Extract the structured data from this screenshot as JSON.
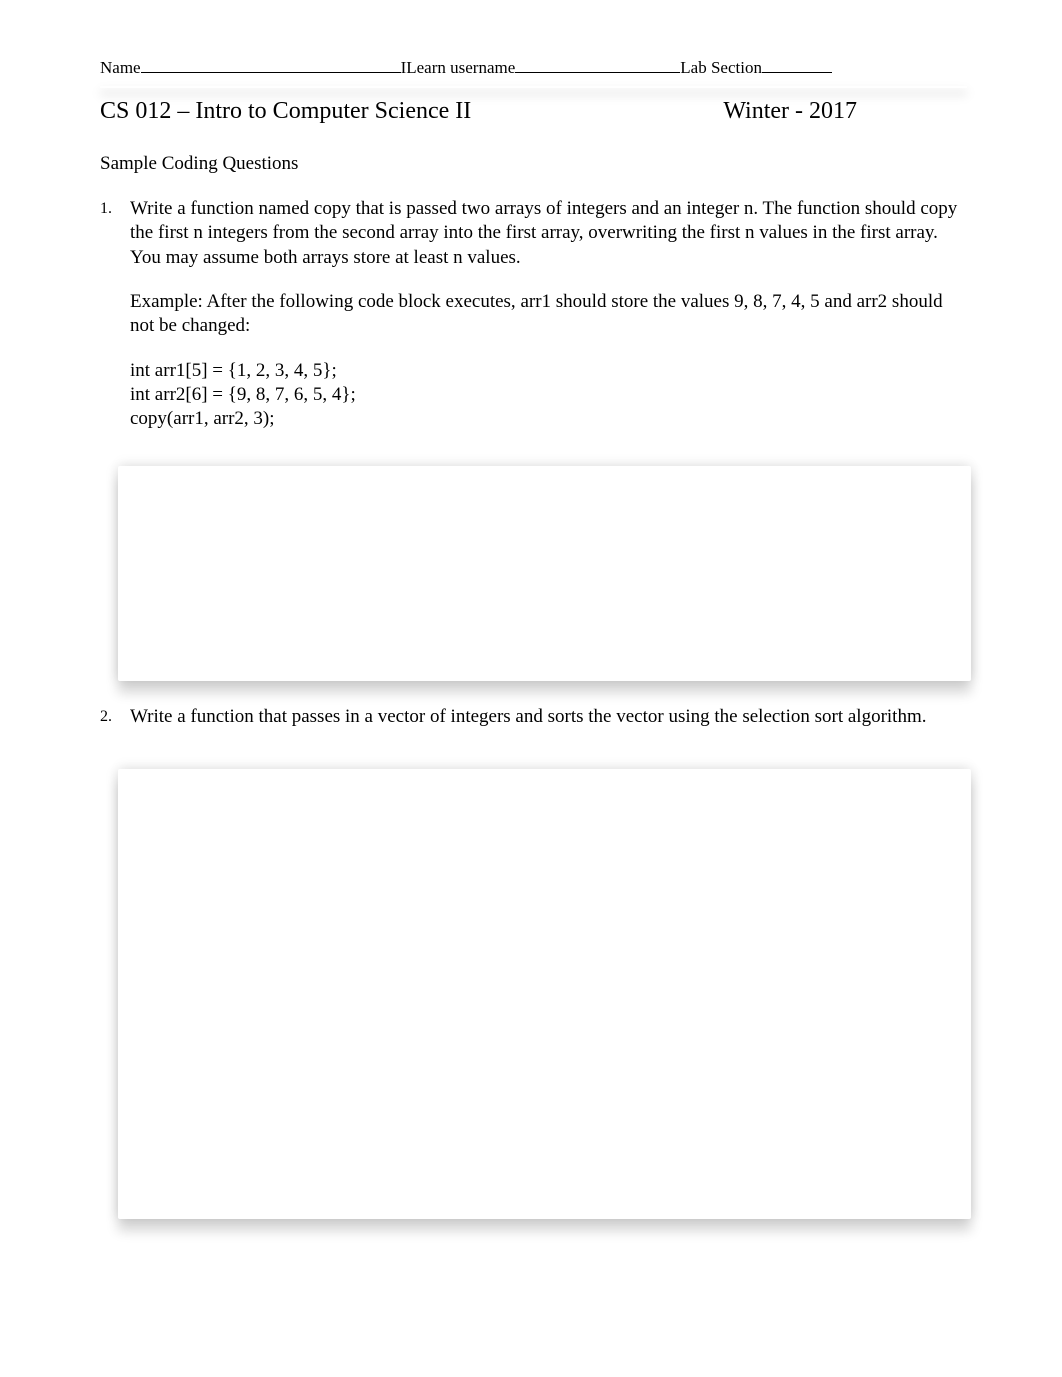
{
  "header": {
    "name_label": "Name",
    "ilearn_label": "ILearn username",
    "lab_label": " Lab Section "
  },
  "course": {
    "code": "CS 012",
    "title_sep": "  – ",
    "title": "Intro to Computer Science II",
    "term": "Winter - 2017"
  },
  "subheading": "Sample Coding Questions",
  "questions": [
    {
      "num": "1.",
      "text": "Write a function named copy that is passed two arrays of integers and an integer n. The function should copy the first n integers from the second array into the first array, overwriting the first n values in the first array. You may assume both arrays store at least n values.",
      "example_pre": "Example: After the following code block executes, ",
      "example_arr1": "arr1",
      "example_mid": "    should store the values 9, 8, 7, 4, 5 and ",
      "example_arr2": "arr2",
      "example_post": "    should not be changed:",
      "code": [
        "int arr1[5] = {1, 2, 3, 4, 5};",
        "int arr2[6] = {9, 8, 7, 6, 5, 4};",
        "copy(arr1, arr2, 3);"
      ]
    },
    {
      "num": "2.",
      "text": "Write a function that passes in a vector of integers and sorts the vector using the selection sort algorithm."
    }
  ]
}
